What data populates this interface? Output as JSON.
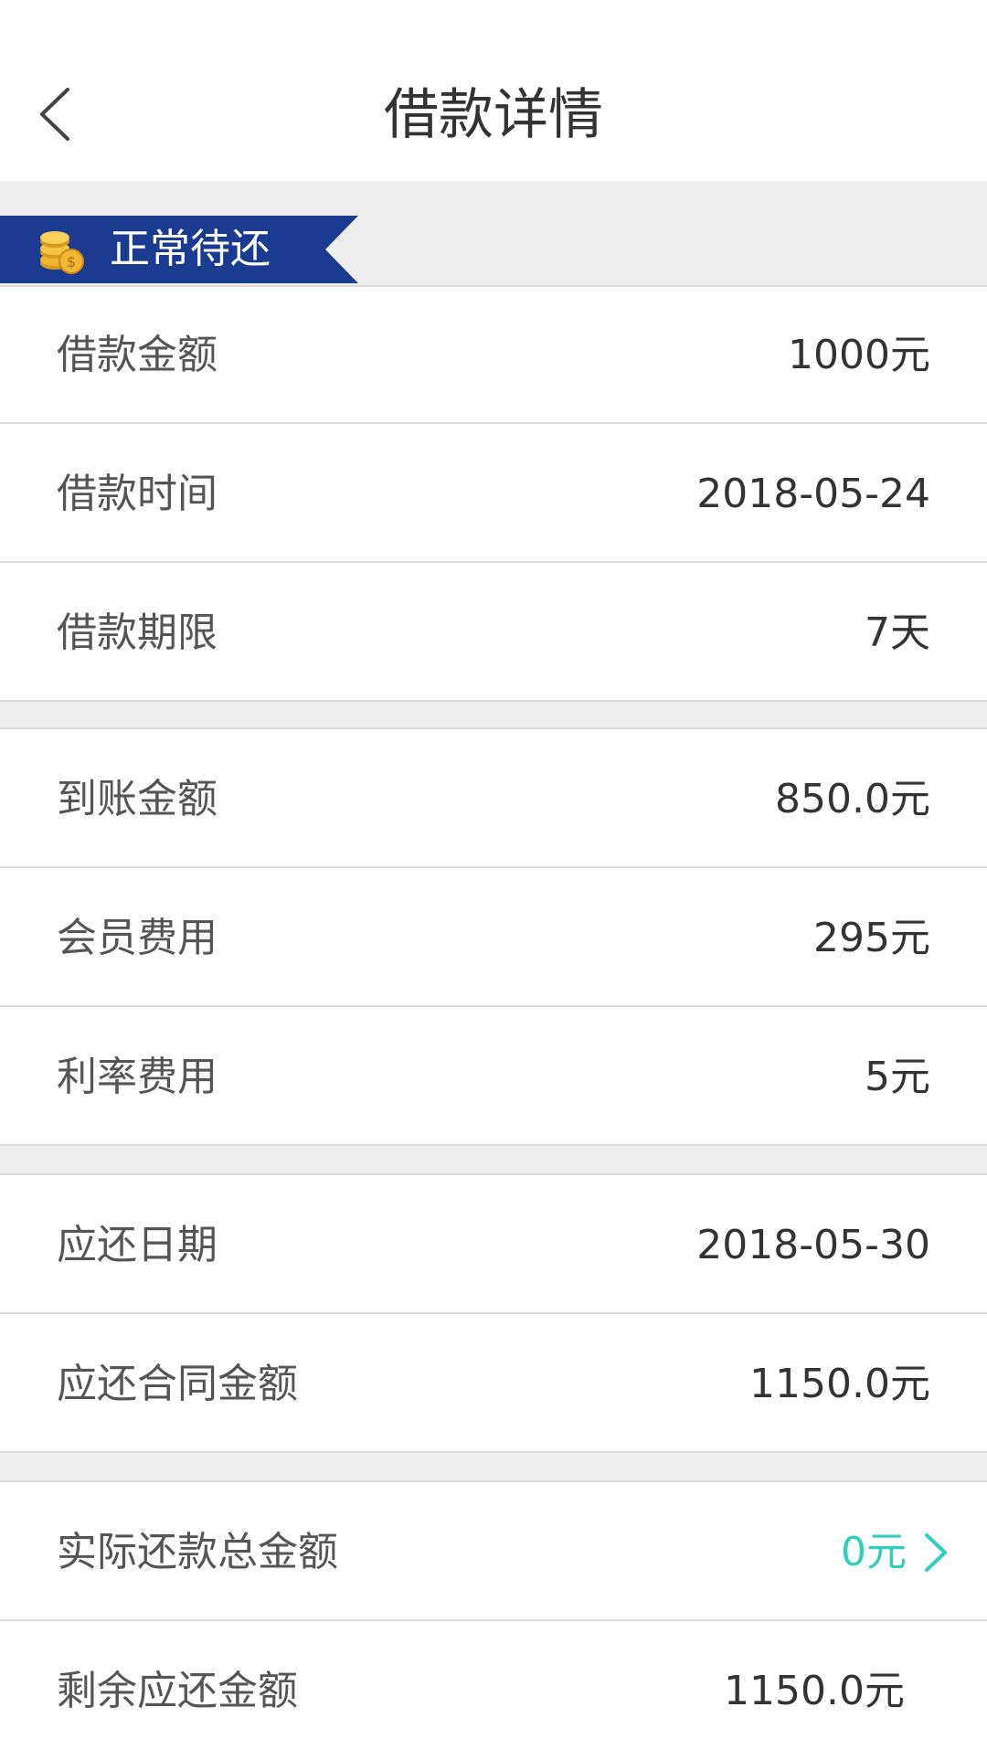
{
  "header": {
    "title": "借款详情"
  },
  "status": {
    "label": "正常待还",
    "banner_color": "#1a3b8f"
  },
  "groups": [
    [
      {
        "label": "借款金额",
        "value": "1000元"
      },
      {
        "label": "借款时间",
        "value": "2018-05-24"
      },
      {
        "label": "借款期限",
        "value": "7天"
      }
    ],
    [
      {
        "label": "到账金额",
        "value": "850.0元"
      },
      {
        "label": "会员费用",
        "value": "295元"
      },
      {
        "label": "利率费用",
        "value": "5元"
      }
    ],
    [
      {
        "label": "应还日期",
        "value": "2018-05-30"
      },
      {
        "label": "应还合同金额",
        "value": "1150.0元"
      }
    ],
    [
      {
        "label": "实际还款总金额",
        "value": "0元"
      },
      {
        "label": "剩余应还金额",
        "value": "1150.0元"
      }
    ]
  ],
  "accent_color": "#2ecfbd"
}
